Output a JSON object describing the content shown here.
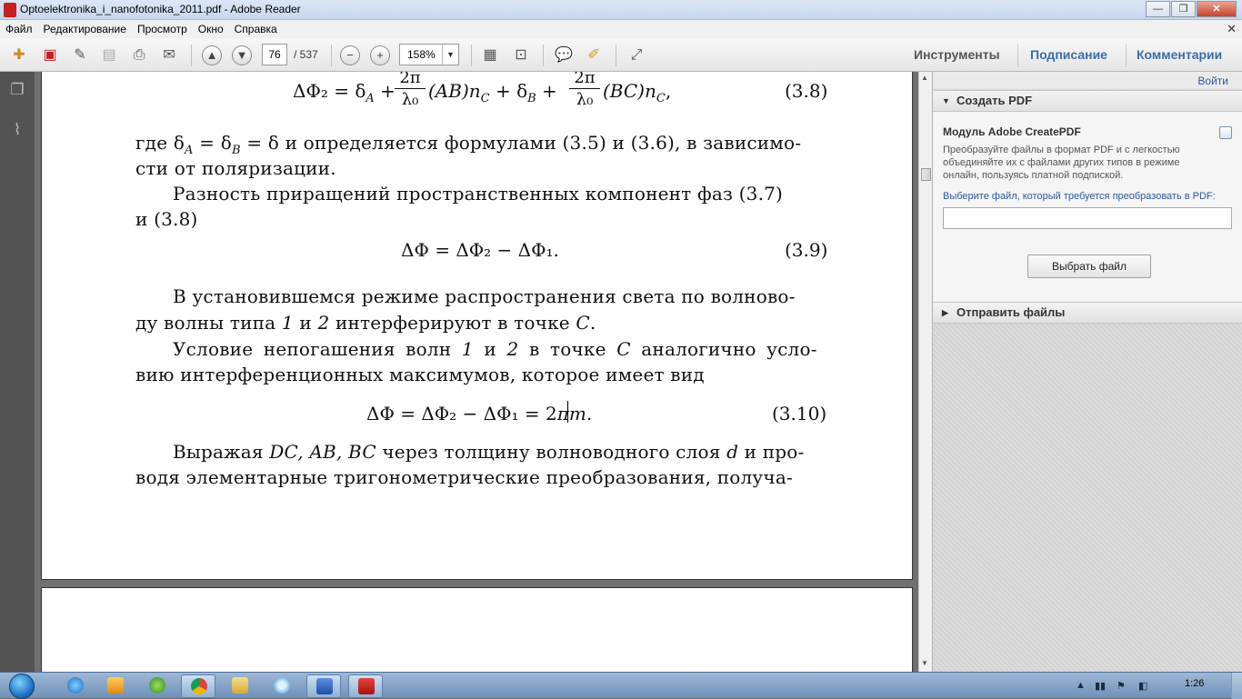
{
  "window": {
    "title": "Optoelektronika_i_nanofotonika_2011.pdf - Adobe Reader",
    "minimize": "—",
    "maximize": "❐",
    "close": "✕"
  },
  "menu": {
    "items": [
      "Файл",
      "Редактирование",
      "Просмотр",
      "Окно",
      "Справка"
    ],
    "close_doc": "✕"
  },
  "toolbar": {
    "page_current": "76",
    "page_total": "/ 537",
    "zoom": "158%",
    "tools_label": "Инструменты",
    "sign_label": "Подписание",
    "comments_label": "Комментарии",
    "icons": [
      "create-pdf",
      "edit-pdf",
      "sign",
      "save",
      "print",
      "email",
      "page-up",
      "page-down",
      "zoom-out",
      "zoom-in",
      "fit-page",
      "fit-width",
      "comment",
      "highlight",
      "fullscreen"
    ]
  },
  "document": {
    "eq_38_lhs": "ΔΦ₂ = δ",
    "eq_38_sub_a": "A",
    "eq_38_plus1": " + ",
    "eq_38_frac_num": "2π",
    "eq_38_frac_den": "λ₀",
    "eq_38_mid1": "(AB)n",
    "eq_38_sub_c": "C",
    "eq_38_mid2": " + δ",
    "eq_38_sub_b": "B",
    "eq_38_plus2": " + ",
    "eq_38_mid3": "(BC)n",
    "eq_38_sub_c2": "C",
    "eq_38_end": ",",
    "eq_38_no": "(3.8)",
    "para1_line1": "где δ",
    "para1_line1_sub_a": "A",
    "para1_line1_mid": " = δ",
    "para1_line1_sub_b": "B",
    "para1_line1_rest": " = δ и определяется формулами (3.5) и (3.6), в зависимо-",
    "para1_line2": "сти от поляризации.",
    "para2_line1": "Разность приращений пространственных компонент фаз (3.7)",
    "para2_line2": "и (3.8)",
    "eq_39": "ΔΦ = ΔΦ₂ − ΔΦ₁.",
    "eq_39_no": "(3.9)",
    "para3_line1": "В установившемся режиме распространения света по волново-",
    "para3_line2_a": "ду волны типа ",
    "para3_line2_1": "1",
    "para3_line2_b": " и ",
    "para3_line2_2": "2",
    "para3_line2_c": " интерферируют в точке ",
    "para3_line2_C": "C",
    "para3_line2_d": ".",
    "para4_line1_a": "Условие непогашения волн ",
    "para4_line1_1": "1",
    "para4_line1_b": " и ",
    "para4_line1_2": "2",
    "para4_line1_c": " в точке ",
    "para4_line1_C": "C",
    "para4_line1_d": " аналогично усло-",
    "para4_line2": "вию интерференционных максимумов, которое имеет вид",
    "eq_310_a": "ΔΦ = ΔΦ₂ − ΔΦ₁ = 2",
    "eq_310_b": "πm.",
    "eq_310_no": "(3.10)",
    "para5_line1_a": "Выражая ",
    "para5_line1_vars": "DC, AB, BC",
    "para5_line1_b": " через толщину волноводного слоя ",
    "para5_line1_d": "d",
    "para5_line1_c": " и про-",
    "para5_line2": "водя элементарные тригонометрические преобразования, получа-"
  },
  "right_pane": {
    "login": "Войти",
    "create_pdf_header": "Создать PDF",
    "module_title": "Модуль Adobe CreatePDF",
    "module_desc": "Преобразуйте файлы в формат PDF и с легкостью объединяйте их с файлами других типов в режиме онлайн, пользуясь платной подпиской.",
    "choose_label": "Выберите файл, который требуется преобразовать в PDF:",
    "file_input_value": "",
    "choose_button": "Выбрать файл",
    "send_files_header": "Отправить файлы"
  },
  "taskbar": {
    "clock": "1:26",
    "apps": [
      "internet-explorer",
      "media-player",
      "media-center",
      "chrome",
      "file-explorer",
      "app",
      "word",
      "adobe-reader"
    ]
  }
}
